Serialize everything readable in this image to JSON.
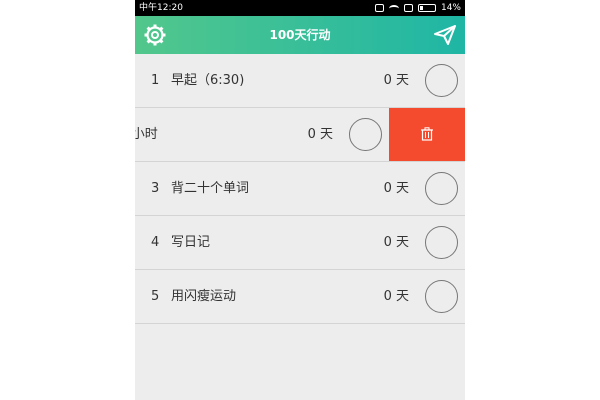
{
  "status_bar": {
    "carrier_time": "中午12:20",
    "battery": "14%"
  },
  "header": {
    "title": "100天行动",
    "left_icon": "gear-icon",
    "right_icon": "send-icon"
  },
  "habits": [
    {
      "index": "1",
      "name": "早起（6:30)",
      "days": "0 天"
    },
    {
      "index": "",
      "name": "-小时",
      "days": "0 天",
      "swiped": true
    },
    {
      "index": "3",
      "name": "背二十个单词",
      "days": "0 天"
    },
    {
      "index": "4",
      "name": "写日记",
      "days": "0 天"
    },
    {
      "index": "5",
      "name": "用闪瘦运动",
      "days": "0 天"
    }
  ],
  "delete_action": {
    "icon": "trash-icon"
  },
  "colors": {
    "header_start": "#52c78c",
    "header_end": "#1fb6a5",
    "delete": "#f44a2e",
    "background": "#ededed"
  }
}
